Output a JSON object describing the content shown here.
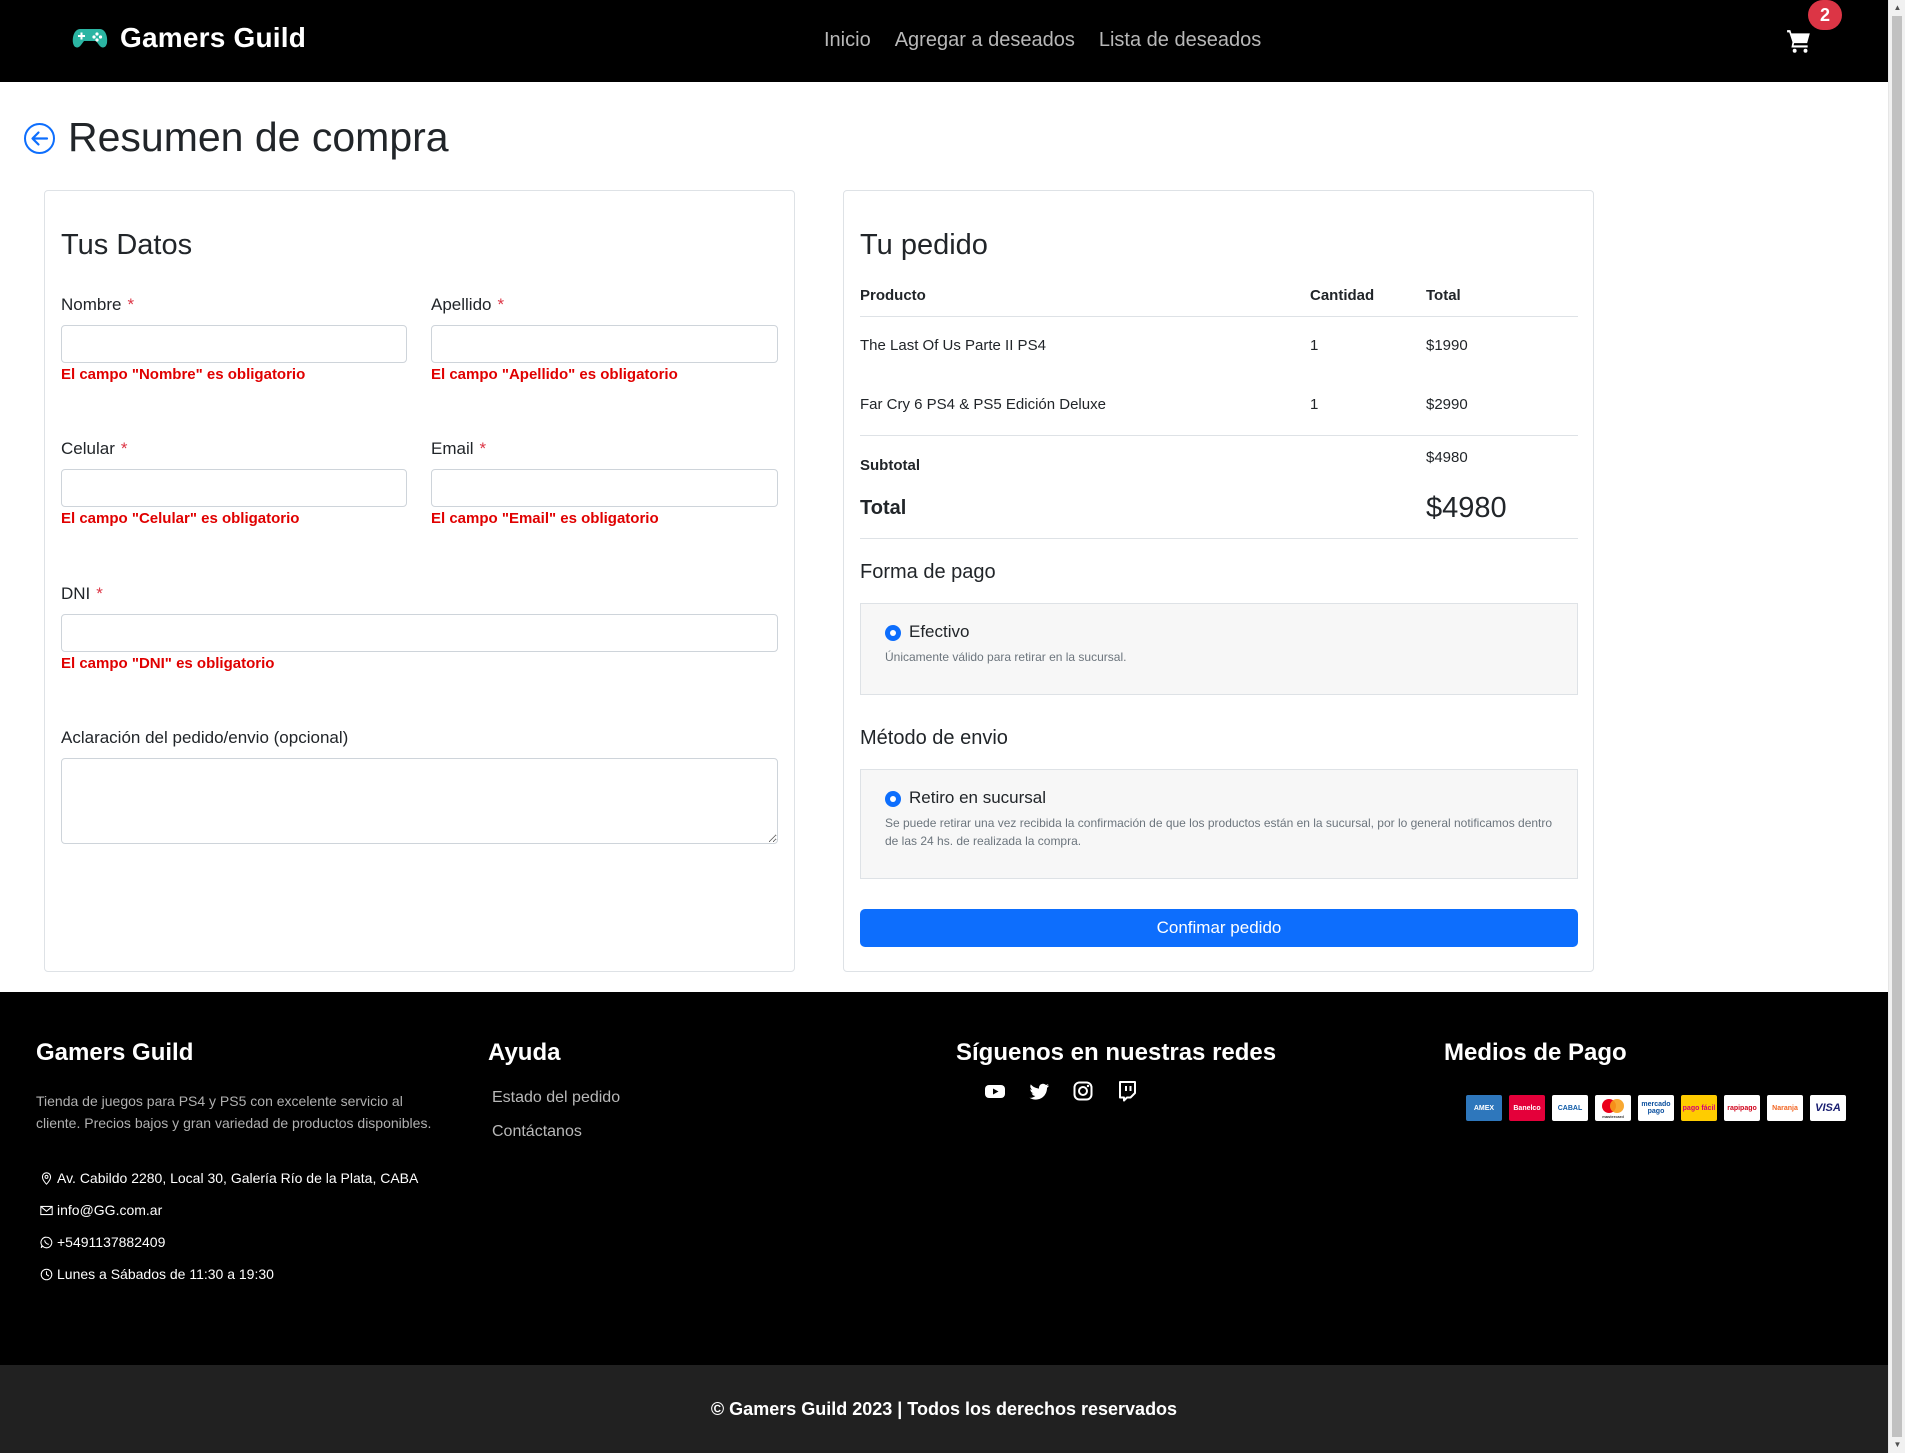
{
  "header": {
    "brand": "Gamers Guild",
    "nav": [
      "Inicio",
      "Agregar a deseados",
      "Lista de deseados"
    ],
    "cart_count": "2"
  },
  "page_title": "Resumen de compra",
  "form": {
    "title": "Tus Datos",
    "required_mark": "*",
    "fields": {
      "nombre": {
        "label": "Nombre",
        "error": "El campo \"Nombre\" es obligatorio"
      },
      "apellido": {
        "label": "Apellido",
        "error": "El campo \"Apellido\" es obligatorio"
      },
      "celular": {
        "label": "Celular",
        "error": "El campo \"Celular\" es obligatorio"
      },
      "email": {
        "label": "Email",
        "error": "El campo \"Email\" es obligatorio"
      },
      "dni": {
        "label": "DNI",
        "error": "El campo \"DNI\" es obligatorio"
      },
      "aclaracion": {
        "label": "Aclaración del pedido/envio (opcional)"
      }
    }
  },
  "order": {
    "title": "Tu pedido",
    "columns": [
      "Producto",
      "Cantidad",
      "Total"
    ],
    "items": [
      {
        "product": "The Last Of Us Parte II PS4",
        "qty": "1",
        "total": "$1990"
      },
      {
        "product": "Far Cry 6 PS4 & PS5 Edición Deluxe",
        "qty": "1",
        "total": "$2990"
      }
    ],
    "subtotal_label": "Subtotal",
    "subtotal_value": "$4980",
    "total_label": "Total",
    "total_value": "$4980",
    "payment": {
      "title": "Forma de pago",
      "option": "Efectivo",
      "desc": "Únicamente válido para retirar en la sucursal."
    },
    "shipping": {
      "title": "Método de envio",
      "option": "Retiro en sucursal",
      "desc": "Se puede retirar una vez recibida la confirmación de que los productos están en la sucursal, por lo general notificamos dentro de las 24 hs. de realizada la compra."
    },
    "confirm_label": "Confimar pedido"
  },
  "footer": {
    "about_title": "Gamers Guild",
    "about_desc": "Tienda de juegos para PS4 y PS5 con excelente servicio al cliente. Precios bajos y gran variedad de productos disponibles.",
    "address": "Av. Cabildo 2280, Local 30, Galería Río de la Plata, CABA",
    "email": "info@GG.com.ar",
    "phone": "+5491137882409",
    "hours": "Lunes a Sábados de 11:30 a 19:30",
    "help_title": "Ayuda",
    "help_links": [
      "Estado del pedido",
      "Contáctanos"
    ],
    "social_title": "Síguenos en nuestras redes",
    "social_icons": [
      "youtube-icon",
      "twitter-icon",
      "instagram-icon",
      "twitch-icon"
    ],
    "payment_title": "Medios de Pago",
    "payment_methods": [
      "AMEX",
      "Banelco",
      "CABAL",
      "mastercard",
      "mercado pago",
      "pago fácil",
      "rapipago",
      "Naranja",
      "VISA"
    ],
    "copyright": "© Gamers Guild 2023 | Todos los derechos reservados"
  },
  "colors": {
    "accent": "#0d6efd",
    "error": "#e00000",
    "badge": "#dc3545",
    "navbar": "#000000"
  }
}
